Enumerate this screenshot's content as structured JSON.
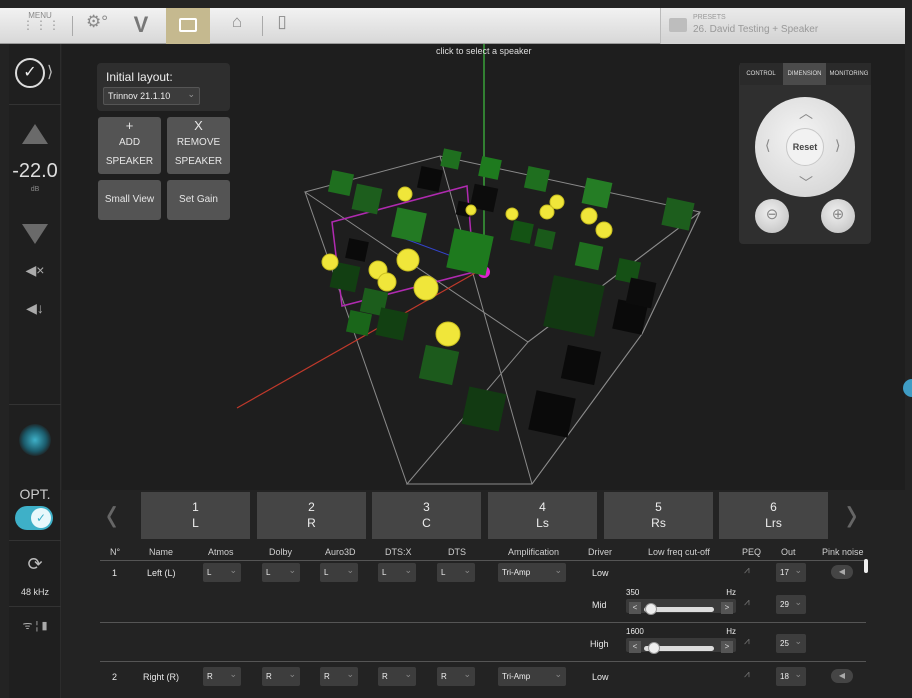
{
  "topbar": {
    "menu_label": "MENU",
    "presets_label": "PRESETS",
    "preset_name": "26. David Testing + Speaker"
  },
  "sidebar": {
    "volume": "-22.0",
    "volume_unit": "dB",
    "opt_label": "OPT.",
    "sample_rate": "48 kHz"
  },
  "viewport": {
    "hint": "click to select a speaker",
    "initial_layout_label": "Initial layout:",
    "layout_value": "Trinnov 21.1.10",
    "add_speaker": {
      "icon": "+",
      "line1": "ADD",
      "line2": "SPEAKER"
    },
    "remove_speaker": {
      "icon": "X",
      "line1": "REMOVE",
      "line2": "SPEAKER"
    },
    "small_view": "Small View",
    "set_gain": "Set Gain"
  },
  "nav": {
    "tabs": [
      "CONTROL",
      "DIMENSION",
      "MONITORING"
    ],
    "active_tab": "DIMENSION",
    "reset": "Reset"
  },
  "speaker_tabs": [
    {
      "num": "1",
      "name": "L"
    },
    {
      "num": "2",
      "name": "R"
    },
    {
      "num": "3",
      "name": "C"
    },
    {
      "num": "4",
      "name": "Ls"
    },
    {
      "num": "5",
      "name": "Rs"
    },
    {
      "num": "6",
      "name": "Lrs"
    }
  ],
  "table": {
    "headers": [
      "N°",
      "Name",
      "Atmos",
      "Dolby",
      "Auro3D",
      "DTS:X",
      "DTS",
      "Amplification",
      "Driver",
      "Low freq cut-off",
      "PEQ",
      "Out",
      "Pink noise"
    ],
    "rows": [
      {
        "n": "1",
        "name": "Left (L)",
        "atmos": "L",
        "dolby": "L",
        "auro": "L",
        "dtsx": "L",
        "dts": "L",
        "amp": "Tri-Amp",
        "drivers": [
          {
            "driver": "Low",
            "out": "17",
            "cutoff": "",
            "hz": ""
          },
          {
            "driver": "Mid",
            "out": "29",
            "cutoff": "350",
            "hz": "Hz"
          },
          {
            "driver": "High",
            "out": "25",
            "cutoff": "1600",
            "hz": "Hz"
          }
        ]
      },
      {
        "n": "2",
        "name": "Right (R)",
        "atmos": "R",
        "dolby": "R",
        "auro": "R",
        "dtsx": "R",
        "dts": "R",
        "amp": "Tri-Amp",
        "drivers": [
          {
            "driver": "Low",
            "out": "18",
            "cutoff": "",
            "hz": ""
          }
        ]
      }
    ]
  },
  "colors": {
    "accent": "#3eb0c8",
    "tab_active": "#c5b98f",
    "speaker_green": "#1e7a1e",
    "speaker_yellow": "#f0e63a"
  }
}
